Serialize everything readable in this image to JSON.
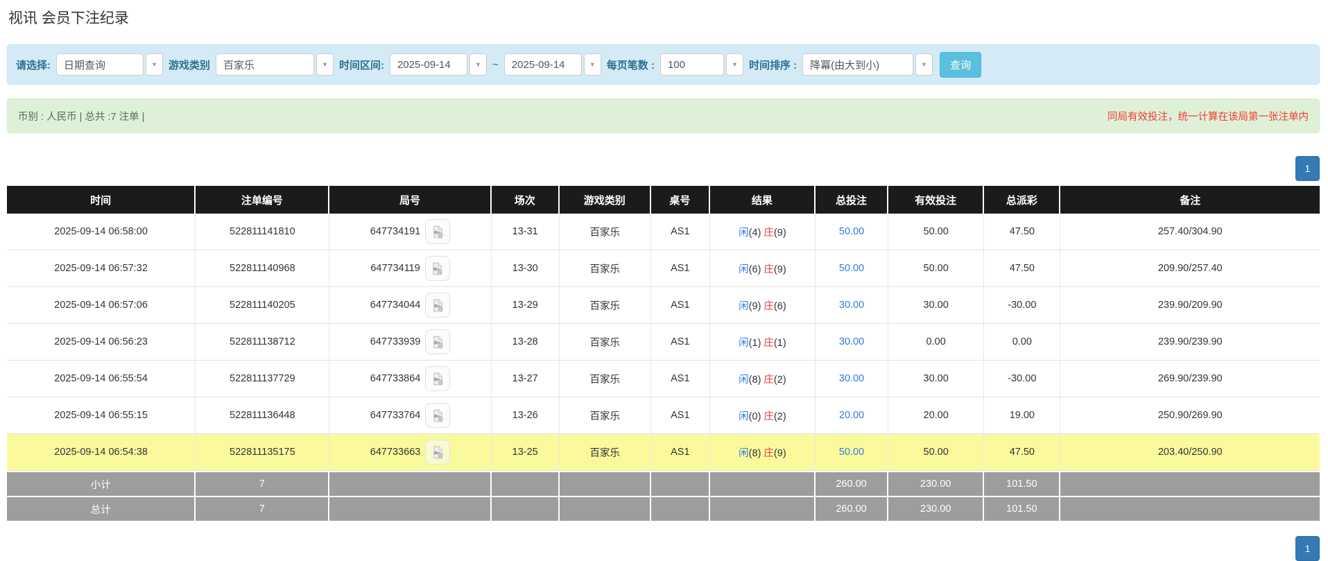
{
  "page": {
    "title": "视讯 会员下注纪录"
  },
  "filters": {
    "select": {
      "label": "请选择:",
      "value": "日期查询"
    },
    "game_type": {
      "label": "游戏类别",
      "value": "百家乐"
    },
    "date_range": {
      "label": "时间区间:",
      "from": "2025-09-14",
      "separator": "~",
      "to": "2025-09-14"
    },
    "page_size": {
      "label": "每页笔数 :",
      "value": "100"
    },
    "time_sort": {
      "label": "时间排序 :",
      "value": "降冪(由大到小)"
    },
    "search_button_label": "查询"
  },
  "summary": {
    "left": "币别 : 人民币 | 总共 :7 注单 |",
    "note": "同局有效投注，统一计算在该局第一张注单内"
  },
  "pagination": {
    "page": "1"
  },
  "icons": {
    "dropdown_arrow": "▼",
    "round_icon_name": "video-file-icon"
  },
  "colors": {
    "header_bg": "#1b1b1b",
    "highlight_yellow": "#fafa9d",
    "subtotal_gray": "#9d9d9d",
    "link_blue": "#2b7ce0",
    "banker_red": "#e33b3b",
    "negative_red": "#ff0000",
    "query_button": "#5bc0de",
    "pagination_blue": "#337ab7"
  },
  "table": {
    "headers": [
      "时间",
      "注单编号",
      "局号",
      "场次",
      "游戏类别",
      "桌号",
      "结果",
      "总投注",
      "有效投注",
      "总派彩",
      "备注"
    ],
    "col_widths_pct": [
      14.38,
      10.21,
      12.32,
      5.18,
      6.98,
      4.49,
      8.04,
      5.55,
      7.3,
      5.82,
      19.73
    ],
    "rows": [
      {
        "time": "2025-09-14 06:58:00",
        "bet_id": "522811141810",
        "round_id": "647734191",
        "session": "13-31",
        "game": "百家乐",
        "table_no": "AS1",
        "result": {
          "player_label": "闲",
          "player_value": "(4)",
          "banker_label": "庄",
          "banker_value": "(9)"
        },
        "total_bet": "50.00",
        "valid_bet": "50.00",
        "payout": "47.50",
        "remark": "257.40/304.90",
        "highlighted": false
      },
      {
        "time": "2025-09-14 06:57:32",
        "bet_id": "522811140968",
        "round_id": "647734119",
        "session": "13-30",
        "game": "百家乐",
        "table_no": "AS1",
        "result": {
          "player_label": "闲",
          "player_value": "(6)",
          "banker_label": "庄",
          "banker_value": "(9)"
        },
        "total_bet": "50.00",
        "valid_bet": "50.00",
        "payout": "47.50",
        "remark": "209.90/257.40",
        "highlighted": false
      },
      {
        "time": "2025-09-14 06:57:06",
        "bet_id": "522811140205",
        "round_id": "647734044",
        "session": "13-29",
        "game": "百家乐",
        "table_no": "AS1",
        "result": {
          "player_label": "闲",
          "player_value": "(9)",
          "banker_label": "庄",
          "banker_value": "(6)"
        },
        "total_bet": "30.00",
        "valid_bet": "30.00",
        "payout": "-30.00",
        "remark": "239.90/209.90",
        "highlighted": false
      },
      {
        "time": "2025-09-14 06:56:23",
        "bet_id": "522811138712",
        "round_id": "647733939",
        "session": "13-28",
        "game": "百家乐",
        "table_no": "AS1",
        "result": {
          "player_label": "闲",
          "player_value": "(1)",
          "banker_label": "庄",
          "banker_value": "(1)"
        },
        "total_bet": "30.00",
        "valid_bet": "0.00",
        "payout": "0.00",
        "remark": "239.90/239.90",
        "highlighted": false
      },
      {
        "time": "2025-09-14 06:55:54",
        "bet_id": "522811137729",
        "round_id": "647733864",
        "session": "13-27",
        "game": "百家乐",
        "table_no": "AS1",
        "result": {
          "player_label": "闲",
          "player_value": "(8)",
          "banker_label": "庄",
          "banker_value": "(2)"
        },
        "total_bet": "30.00",
        "valid_bet": "30.00",
        "payout": "-30.00",
        "remark": "269.90/239.90",
        "highlighted": false
      },
      {
        "time": "2025-09-14 06:55:15",
        "bet_id": "522811136448",
        "round_id": "647733764",
        "session": "13-26",
        "game": "百家乐",
        "table_no": "AS1",
        "result": {
          "player_label": "闲",
          "player_value": "(0)",
          "banker_label": "庄",
          "banker_value": "(2)"
        },
        "total_bet": "20.00",
        "valid_bet": "20.00",
        "payout": "19.00",
        "remark": "250.90/269.90",
        "highlighted": false
      },
      {
        "time": "2025-09-14 06:54:38",
        "bet_id": "522811135175",
        "round_id": "647733663",
        "session": "13-25",
        "game": "百家乐",
        "table_no": "AS1",
        "result": {
          "player_label": "闲",
          "player_value": "(8)",
          "banker_label": "庄",
          "banker_value": "(9)"
        },
        "total_bet": "50.00",
        "valid_bet": "50.00",
        "payout": "47.50",
        "remark": "203.40/250.90",
        "highlighted": true
      }
    ],
    "subtotal": {
      "label": "小计",
      "count": "7",
      "total_bet": "260.00",
      "valid_bet": "230.00",
      "payout": "101.50"
    },
    "total": {
      "label": "总计",
      "count": "7",
      "total_bet": "260.00",
      "valid_bet": "230.00",
      "payout": "101.50"
    }
  }
}
